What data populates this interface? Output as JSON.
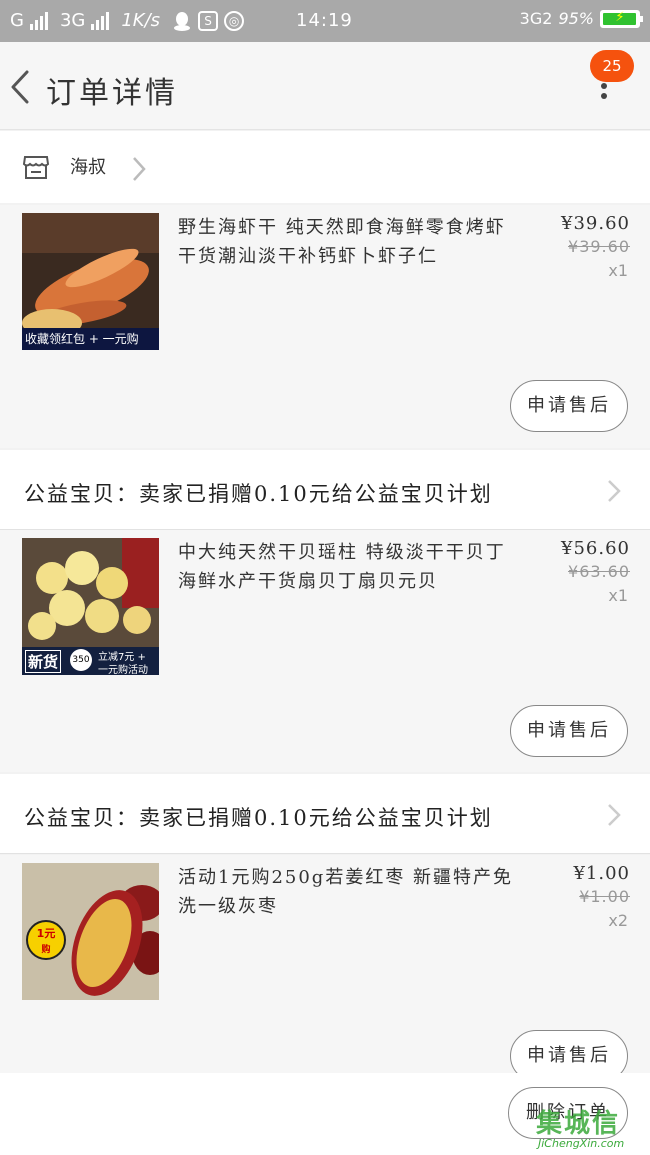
{
  "status_bar": {
    "carrier_1": "G",
    "carrier_2": "3G",
    "speed": "1K/s",
    "time": "14:19",
    "net": "3G2",
    "battery": "95%"
  },
  "nav": {
    "title": "订单详情",
    "badge": "25"
  },
  "shop": {
    "name": "海叔"
  },
  "items": [
    {
      "title": "野生海虾干 纯天然即食海鲜零食烤虾干货潮汕淡干补钙虾卜虾子仁",
      "price": "¥39.60",
      "original_price": "¥39.60",
      "qty": "x1",
      "after_sale": "申请售后",
      "thumb_banner": "收藏领红包 + 一元购"
    },
    {
      "title": "中大纯天然干贝瑶柱 特级淡干干贝丁海鲜水产干货扇贝丁扇贝元贝",
      "price": "¥56.60",
      "original_price": "¥63.60",
      "qty": "x1",
      "after_sale": "申请售后",
      "thumb_banner_a": "新货",
      "thumb_banner_b": "350",
      "thumb_banner_c": "立减7元 +",
      "thumb_banner_d": "一元购活动"
    },
    {
      "title": "活动1元购250g若姜红枣 新疆特产免洗一级灰枣",
      "price": "¥1.00",
      "original_price": "¥1.00",
      "qty": "x2",
      "after_sale": "申请售后",
      "thumb_badge_a": "1元",
      "thumb_badge_b": "购"
    }
  ],
  "charity": {
    "text": "公益宝贝：卖家已捐赠0.10元给公益宝贝计划"
  },
  "bottom": {
    "delete_order": "删除订单",
    "watermark": "集城信",
    "watermark_url": "JiChengXin.com"
  },
  "colors": {
    "badge": "#f5520e",
    "status_bar": "#a9a9a9"
  }
}
